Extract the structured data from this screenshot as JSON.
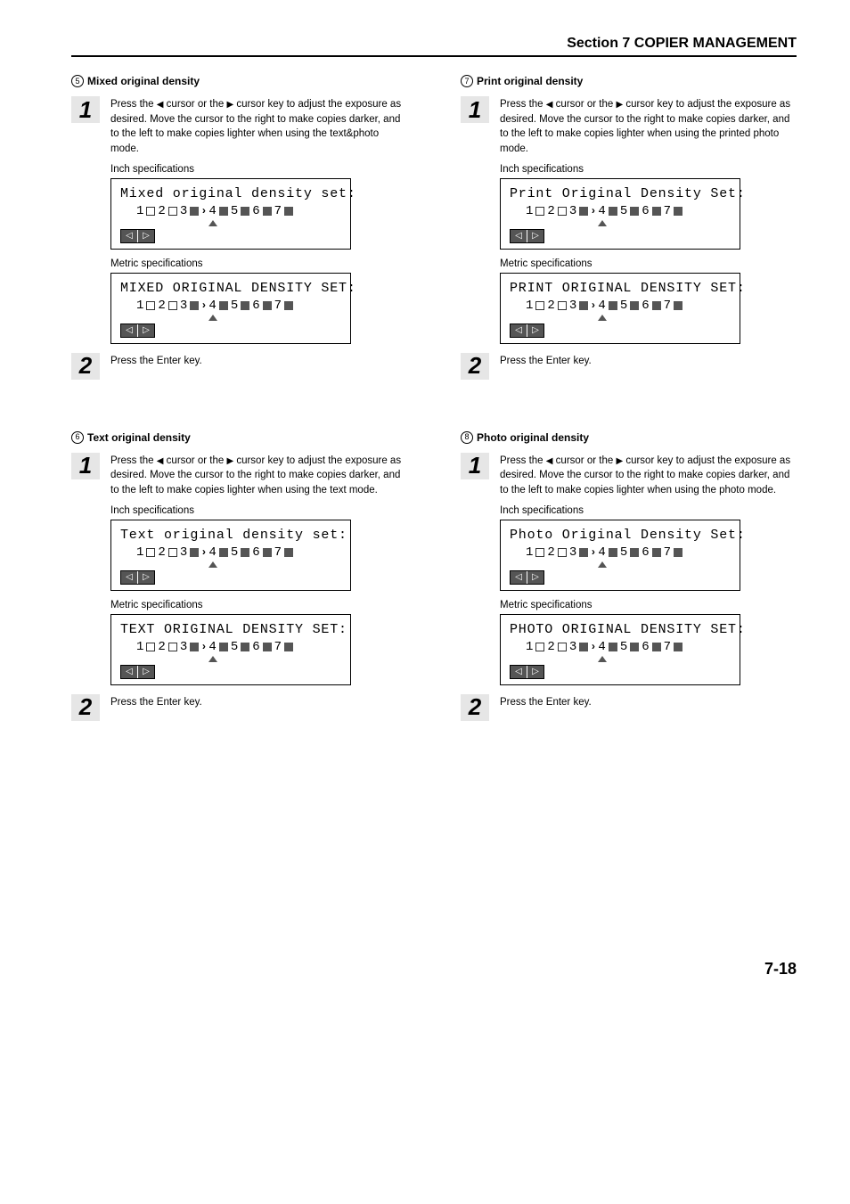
{
  "header": "Section 7  COPIER MANAGEMENT",
  "page_number": "7-18",
  "common": {
    "step1_text_prefix": "Press the ",
    "left_cursor": "◀",
    "right_cursor": "▶",
    "step1_text_mid": " cursor or the ",
    "step1_text_after": " cursor key to adjust the exposure as desired. Move the cursor to the right to make copies darker, and to the left to make copies lighter when using the ",
    "step2_text": "Press the Enter key.",
    "inch_label": "Inch specifications",
    "metric_label": "Metric specifications",
    "density_levels": [
      "1",
      "2",
      "3",
      "4",
      "5",
      "6",
      "7"
    ],
    "selected_level": 4
  },
  "sections": [
    {
      "num": "5",
      "title": "Mixed original density",
      "mode_suffix": "text&photo mode.",
      "lcd_inch": "Mixed original density set:",
      "lcd_metric": "MIXED ORIGINAL DENSITY SET:"
    },
    {
      "num": "6",
      "title": "Text original density",
      "mode_suffix": "text mode.",
      "lcd_inch": "Text original density set:",
      "lcd_metric": "TEXT ORIGINAL DENSITY SET:"
    },
    {
      "num": "7",
      "title": "Print original density",
      "mode_suffix": "printed photo mode.",
      "lcd_inch": "Print Original Density Set:",
      "lcd_metric": "PRINT ORIGINAL DENSITY SET:"
    },
    {
      "num": "8",
      "title": "Photo original density",
      "mode_suffix": "photo mode.",
      "lcd_inch": "Photo Original Density Set:",
      "lcd_metric": "PHOTO ORIGINAL DENSITY SET:"
    }
  ]
}
